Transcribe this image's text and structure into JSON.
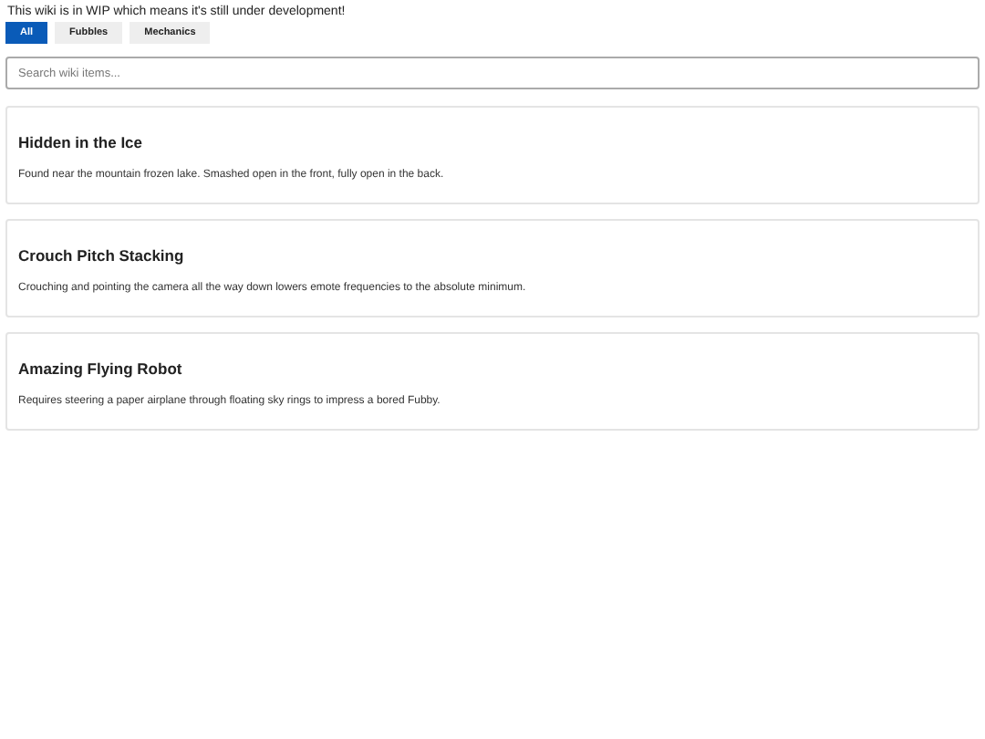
{
  "notice": "This wiki is in WIP which means it's still under development!",
  "tabs": [
    {
      "label": "All",
      "selected": true
    },
    {
      "label": "Fubbles",
      "selected": false
    },
    {
      "label": "Mechanics",
      "selected": false
    }
  ],
  "search": {
    "placeholder": "Search wiki items..."
  },
  "items": [
    {
      "title": "Hidden in the Ice",
      "description": "Found near the mountain frozen lake. Smashed open in the front, fully open in the back."
    },
    {
      "title": "Crouch Pitch Stacking",
      "description": "Crouching and pointing the camera all the way down lowers emote frequencies to the absolute minimum."
    },
    {
      "title": "Amazing Flying Robot",
      "description": "Requires steering a paper airplane through floating sky rings to impress a bored Fubby."
    }
  ]
}
